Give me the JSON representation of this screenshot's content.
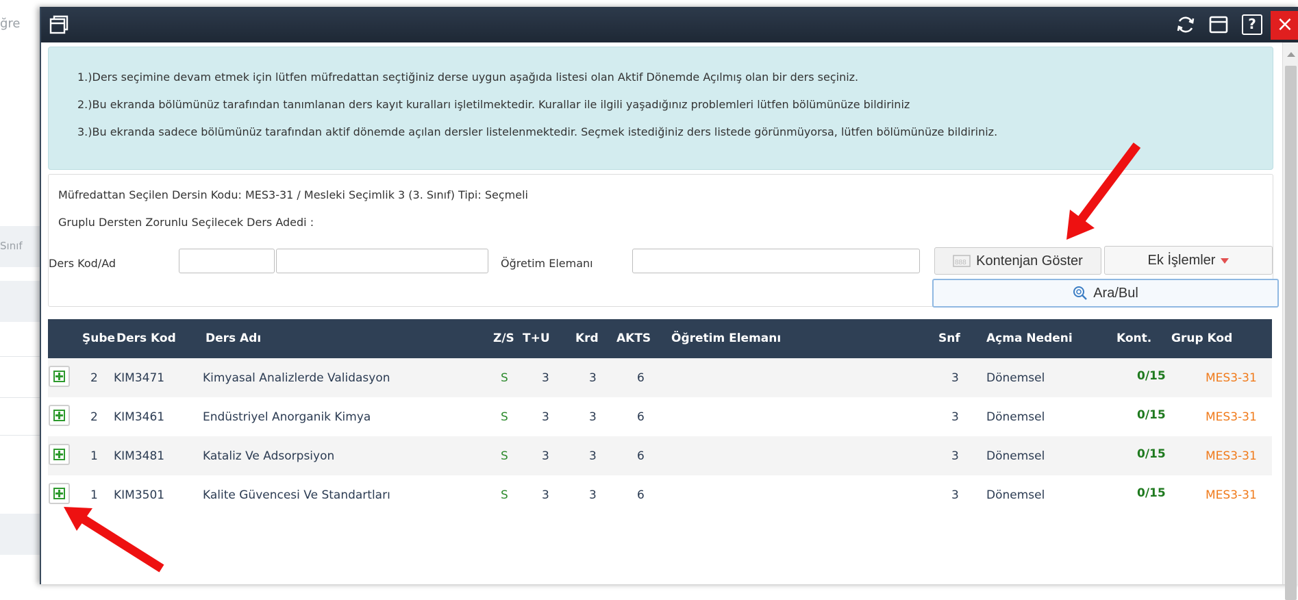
{
  "background": {
    "fragment_top": "ğre",
    "fragment_mid": "Sınıf"
  },
  "titlebar": {
    "window_icon": "restore-window-icon",
    "refresh_icon": "refresh-icon",
    "maximize_icon": "maximize-icon",
    "help_icon": "help-icon",
    "help_label": "?",
    "close_label": "×"
  },
  "info": {
    "line1": "1.)Ders seçimine devam etmek için lütfen müfredattan seçtiğiniz derse uygun aşağıda listesi olan Aktif Dönemde Açılmış olan bir ders seçiniz.",
    "line2": "2.)Bu ekranda bölümünüz tarafından tanımlanan ders kayıt kuralları işletilmektedir. Kurallar ile ilgili yaşadığınız problemleri lütfen bölümünüze bildiriniz",
    "line3": "3.)Bu ekranda sadece bölümünüz tarafından aktif dönemde açılan dersler listelenmektedir. Seçmek istediğiniz ders listede görünmüyorsa, lütfen bölümünüze bildiriniz."
  },
  "filter": {
    "course_info": "Müfredattan Seçilen Dersin Kodu: MES3-31 / Mesleki Seçimlik 3 (3. Sınıf) Tipi: Seçmeli",
    "group_info": "Gruplu Dersten Zorunlu Seçilecek Ders Adedi :",
    "ders_label": "Ders Kod/Ad",
    "ders_kod_value": "",
    "ders_ad_value": "",
    "ogretim_label": "Öğretim Elemanı",
    "ogretim_value": "",
    "kontenjan_label": "Kontenjan Göster",
    "ek_label": "Ek İşlemler",
    "ara_label": "Ara/Bul"
  },
  "table": {
    "headers": {
      "sube": "Şube",
      "kod": "Ders Kod",
      "ad": "Ders Adı",
      "zs": "Z/S",
      "tu": "T+U",
      "krd": "Krd",
      "akts": "AKTS",
      "ogr": "Öğretim Elemanı",
      "snf": "Snf",
      "neden": "Açma Nedeni",
      "kont": "Kont.",
      "grup": "Grup Kod"
    },
    "rows": [
      {
        "sube": "2",
        "kod": "KIM3471",
        "ad": "Kimyasal Analizlerde Validasyon",
        "zs": "S",
        "tu": "3",
        "krd": "3",
        "akts": "6",
        "ogr": "",
        "snf": "3",
        "neden": "Dönemsel",
        "kont": "0/15",
        "grup": "MES3-31"
      },
      {
        "sube": "2",
        "kod": "KIM3461",
        "ad": "Endüstriyel Anorganik Kimya",
        "zs": "S",
        "tu": "3",
        "krd": "3",
        "akts": "6",
        "ogr": "",
        "snf": "3",
        "neden": "Dönemsel",
        "kont": "0/15",
        "grup": "MES3-31"
      },
      {
        "sube": "1",
        "kod": "KIM3481",
        "ad": "Kataliz Ve Adsorpsiyon",
        "zs": "S",
        "tu": "3",
        "krd": "3",
        "akts": "6",
        "ogr": "",
        "snf": "3",
        "neden": "Dönemsel",
        "kont": "0/15",
        "grup": "MES3-31"
      },
      {
        "sube": "1",
        "kod": "KIM3501",
        "ad": "Kalite Güvencesi Ve Standartları",
        "zs": "S",
        "tu": "3",
        "krd": "3",
        "akts": "6",
        "ogr": "",
        "snf": "3",
        "neden": "Dönemsel",
        "kont": "0/15",
        "grup": "MES3-31"
      }
    ]
  },
  "colors": {
    "titlebar": "#2d3a4b",
    "info_bg": "#d3ecef",
    "table_header": "#2f4055",
    "zs_green": "#2e8b2e",
    "group_orange": "#f07a1a",
    "annotation_red": "#ee1111"
  }
}
